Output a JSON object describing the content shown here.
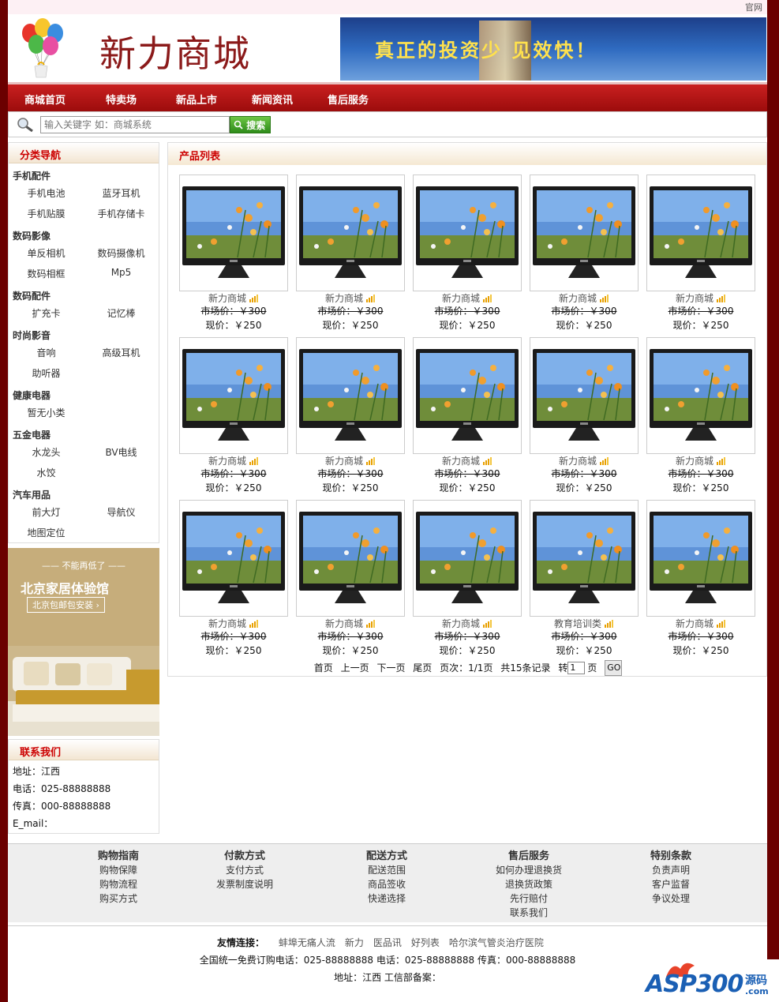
{
  "top": {
    "link": "官网"
  },
  "header": {
    "brand": "新力商城",
    "banner_text": "真正的投资少 见效快！"
  },
  "nav": [
    "商城首页",
    "特卖场",
    "新品上市",
    "新闻资讯",
    "售后服务"
  ],
  "search": {
    "placeholder": "输入关键字 如：商城系统",
    "button": "搜索"
  },
  "sidebar": {
    "title": "分类导航",
    "categories": [
      {
        "name": "手机配件",
        "subs": [
          "手机电池",
          "蓝牙耳机",
          "手机贴膜",
          "手机存储卡"
        ]
      },
      {
        "name": "数码影像",
        "subs": [
          "单反相机",
          "数码摄像机",
          "数码相框",
          "Mp5"
        ]
      },
      {
        "name": "数码配件",
        "subs": [
          "扩充卡",
          "记忆棒"
        ]
      },
      {
        "name": "时尚影音",
        "subs": [
          "音响",
          "高级耳机",
          "助听器"
        ]
      },
      {
        "name": "健康电器",
        "subs": [
          "暂无小类"
        ]
      },
      {
        "name": "五金电器",
        "subs": [
          "水龙头",
          "BV电线",
          "水饺"
        ]
      },
      {
        "name": "汽车用品",
        "subs": [
          "前大灯",
          "导航仪",
          "地图定位"
        ]
      }
    ]
  },
  "promo": {
    "top": "不能再低了",
    "title": "北京家居体验馆",
    "sub": "北京包邮包安装 ›"
  },
  "contact": {
    "title": "联系我们",
    "lines": [
      "地址：江西",
      "电话：025-88888888",
      "传真：000-88888888",
      "E_mail："
    ]
  },
  "main": {
    "title": "产品列表",
    "products": [
      {
        "name": "新力商城",
        "market": "市场价：￥300",
        "now": "现价：￥250"
      },
      {
        "name": "新力商城",
        "market": "市场价：￥300",
        "now": "现价：￥250"
      },
      {
        "name": "新力商城",
        "market": "市场价：￥300",
        "now": "现价：￥250"
      },
      {
        "name": "新力商城",
        "market": "市场价：￥300",
        "now": "现价：￥250"
      },
      {
        "name": "新力商城",
        "market": "市场价：￥300",
        "now": "现价：￥250"
      },
      {
        "name": "新力商城",
        "market": "市场价：￥300",
        "now": "现价：￥250"
      },
      {
        "name": "新力商城",
        "market": "市场价：￥300",
        "now": "现价：￥250"
      },
      {
        "name": "新力商城",
        "market": "市场价：￥300",
        "now": "现价：￥250"
      },
      {
        "name": "新力商城",
        "market": "市场价：￥300",
        "now": "现价：￥250"
      },
      {
        "name": "新力商城",
        "market": "市场价：￥300",
        "now": "现价：￥250"
      },
      {
        "name": "新力商城",
        "market": "市场价：￥300",
        "now": "现价：￥250"
      },
      {
        "name": "新力商城",
        "market": "市场价：￥300",
        "now": "现价：￥250"
      },
      {
        "name": "新力商城",
        "market": "市场价：￥300",
        "now": "现价：￥250"
      },
      {
        "name": "教育培训类",
        "market": "市场价：￥300",
        "now": "现价：￥250"
      },
      {
        "name": "新力商城",
        "market": "市场价：￥300",
        "now": "现价：￥250"
      }
    ],
    "pager": {
      "first": "首页",
      "prev": "上一页",
      "next": "下一页",
      "last": "尾页",
      "info": "页次：1/1页",
      "total": "共15条记录",
      "goto": "转",
      "page_value": "1",
      "page": "页",
      "go": "GO"
    }
  },
  "footer": {
    "columns": [
      {
        "title": "购物指南",
        "items": [
          "购物保障",
          "购物流程",
          "购买方式"
        ]
      },
      {
        "title": "付款方式",
        "items": [
          "支付方式",
          "发票制度说明"
        ]
      },
      {
        "title": "配送方式",
        "items": [
          "配送范围",
          "商品签收",
          "快递选择"
        ]
      },
      {
        "title": "售后服务",
        "items": [
          "如何办理退换货",
          "退换货政策",
          "先行赔付",
          "联系我们"
        ]
      },
      {
        "title": "特别条款",
        "items": [
          "负责声明",
          "客户监督",
          "争议处理"
        ]
      }
    ]
  },
  "bottom": {
    "links_label": "友情连接：",
    "links": [
      "蚌埠无痛人流",
      "新力",
      "医品讯",
      "好列表",
      "哈尔滨气管炎治疗医院"
    ],
    "phone_line": "全国统一免费订购电话：025-88888888 电话：025-88888888 传真：000-88888888",
    "address_line": "地址：江西 工信部备案："
  },
  "watermark": {
    "main": "ASP300",
    "cn": "源码",
    "com": ".com"
  }
}
